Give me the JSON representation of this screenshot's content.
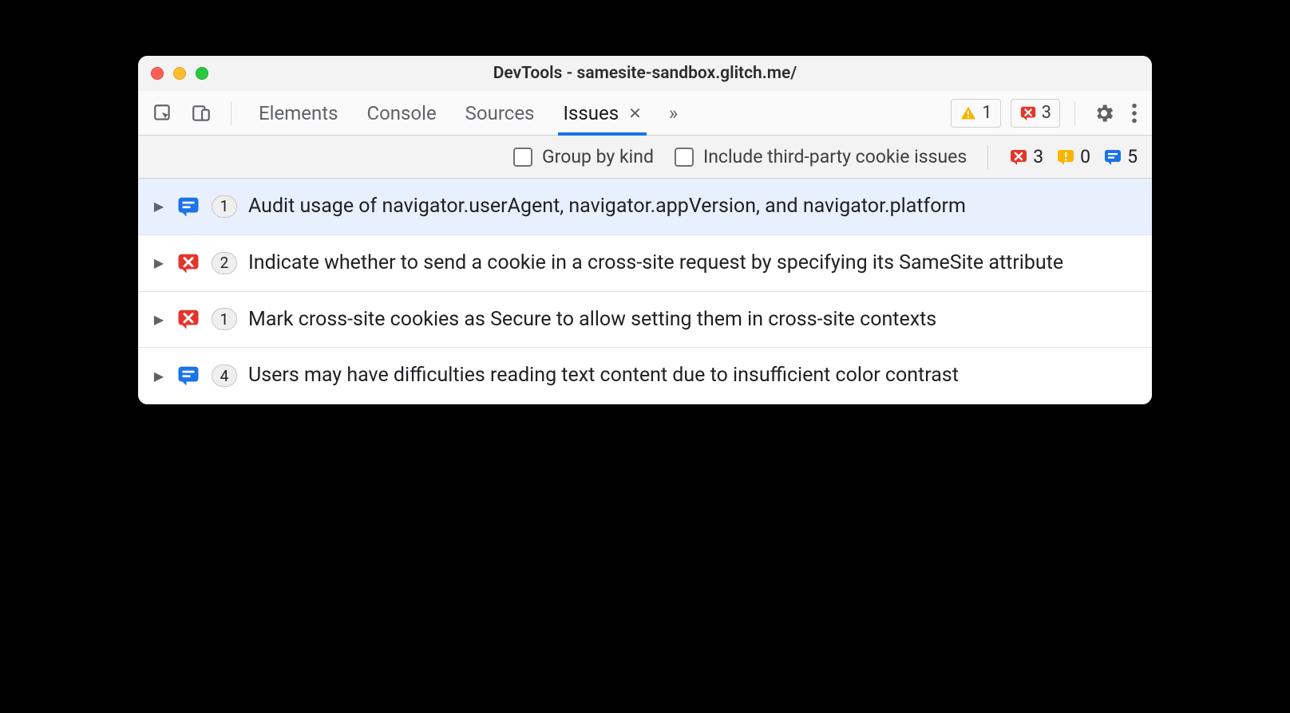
{
  "window": {
    "title": "DevTools - samesite-sandbox.glitch.me/"
  },
  "tabs": {
    "items": [
      {
        "label": "Elements",
        "active": false
      },
      {
        "label": "Console",
        "active": false
      },
      {
        "label": "Sources",
        "active": false
      },
      {
        "label": "Issues",
        "active": true,
        "closable": true
      }
    ]
  },
  "toolbar_counters": {
    "warnings": "1",
    "errors": "3"
  },
  "filters": {
    "group_by_kind_label": "Group by kind",
    "include_third_party_label": "Include third-party cookie issues"
  },
  "kind_counts": {
    "error": "3",
    "improvement": "0",
    "info": "5"
  },
  "issues": [
    {
      "kind": "info",
      "count": "1",
      "title": "Audit usage of navigator.userAgent, navigator.appVersion, and navigator.platform",
      "selected": true
    },
    {
      "kind": "error",
      "count": "2",
      "title": "Indicate whether to send a cookie in a cross-site request by specifying its SameSite attribute",
      "selected": false
    },
    {
      "kind": "error",
      "count": "1",
      "title": "Mark cross-site cookies as Secure to allow setting them in cross-site contexts",
      "selected": false
    },
    {
      "kind": "info",
      "count": "4",
      "title": "Users may have difficulties reading text content due to insufficient color contrast",
      "selected": false
    }
  ]
}
